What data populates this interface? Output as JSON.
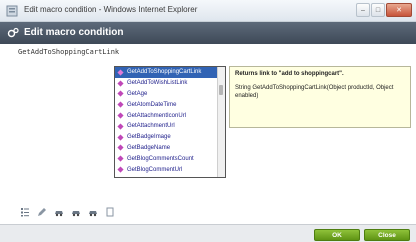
{
  "window": {
    "title": "Edit macro condition - Windows Internet Explorer",
    "controls": {
      "minimize": "–",
      "maximize": "□",
      "close": "✕"
    }
  },
  "dialog": {
    "title": "Edit macro condition"
  },
  "editor": {
    "text": "GetAddToShoppingCartLink"
  },
  "autocomplete": {
    "items": [
      {
        "label": "GetAddToShoppingCartLink",
        "selected": true
      },
      {
        "label": "GetAddToWishListLink",
        "selected": false
      },
      {
        "label": "GetAge",
        "selected": false
      },
      {
        "label": "GetAtomDateTime",
        "selected": false
      },
      {
        "label": "GetAttachmentIconUrl",
        "selected": false
      },
      {
        "label": "GetAttachmentUrl",
        "selected": false
      },
      {
        "label": "GetBadgeImage",
        "selected": false
      },
      {
        "label": "GetBadgeName",
        "selected": false
      },
      {
        "label": "GetBlogCommentsCount",
        "selected": false
      },
      {
        "label": "GetBlogCommentUrl",
        "selected": false
      }
    ],
    "item_icon": "method-icon"
  },
  "tooltip": {
    "title": "Returns link to \"add to shoppingcart\".",
    "signature": "String GetAddToShoppingCartLink(Object productId, Object enabled)"
  },
  "toolbar": {
    "icons": [
      "list-icon",
      "edit-icon",
      "car-icon",
      "car-icon",
      "car-icon",
      "page-icon"
    ]
  },
  "footer": {
    "ok_label": "OK",
    "close_label": "Close"
  },
  "colors": {
    "header": "#4a5666",
    "selection": "#3163b4",
    "tooltip_bg": "#ffffe1",
    "button_green": "#6fa81f"
  }
}
